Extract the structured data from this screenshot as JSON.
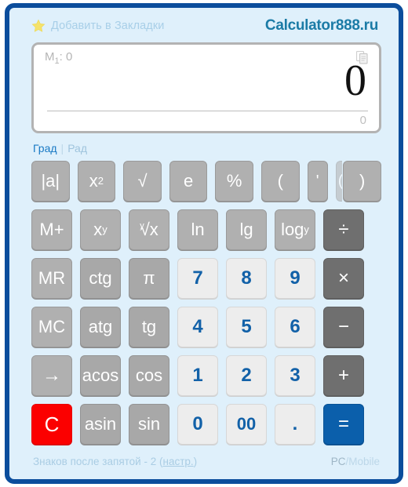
{
  "header": {
    "bookmark_label": "Добавить в Закладки",
    "star_icon": "star-icon",
    "logo": "Calculator888.ru"
  },
  "display": {
    "memory_label_prefix": "M",
    "memory_index": "1",
    "memory_label_suffix": ": 0",
    "copy_icon": "copy-icon",
    "main_value": "0",
    "sub_value": "0"
  },
  "mode": {
    "active_label": "Град",
    "separator": "|",
    "inactive_label": "Рад"
  },
  "keypad": {
    "rows": [
      [
        {
          "label": "|a|",
          "type": "fn",
          "name": "abs-button"
        },
        {
          "label": "x²",
          "type": "fn",
          "name": "square-button"
        },
        {
          "label": "√",
          "type": "fn",
          "name": "sqrt-button"
        },
        {
          "label": "e",
          "type": "fn",
          "name": "e-button"
        },
        {
          "label": "%",
          "type": "fn",
          "name": "percent-button"
        },
        {
          "label": "(",
          "type": "fn",
          "name": "open-paren-button"
        },
        {
          "label": "'",
          "type": "fn-narrow",
          "name": "apostrophe-button"
        },
        {
          "label": "(",
          "type": "fn-sliver",
          "name": "open-paren-partial-button"
        },
        {
          "label": ")",
          "type": "fn",
          "name": "close-paren-button"
        }
      ],
      [
        {
          "label": "M+",
          "type": "fn",
          "name": "memory-add-button"
        },
        {
          "label": "x^y",
          "type": "fn",
          "name": "power-button"
        },
        {
          "label": "y√x",
          "type": "fn",
          "name": "nth-root-button"
        },
        {
          "label": "ln",
          "type": "fn",
          "name": "ln-button"
        },
        {
          "label": "lg",
          "type": "fn",
          "name": "lg-button"
        },
        {
          "label": "log y",
          "type": "fn",
          "name": "log-base-y-button"
        },
        {
          "label": "÷",
          "type": "op",
          "name": "divide-button"
        }
      ],
      [
        {
          "label": "MR",
          "type": "fn",
          "name": "memory-recall-button"
        },
        {
          "label": "ctg",
          "type": "fn-dark",
          "name": "ctg-button"
        },
        {
          "label": "π",
          "type": "fn-dark",
          "name": "pi-button"
        },
        {
          "label": "7",
          "type": "num",
          "name": "digit-7-button"
        },
        {
          "label": "8",
          "type": "num",
          "name": "digit-8-button"
        },
        {
          "label": "9",
          "type": "num",
          "name": "digit-9-button"
        },
        {
          "label": "×",
          "type": "op",
          "name": "multiply-button"
        }
      ],
      [
        {
          "label": "MC",
          "type": "fn",
          "name": "memory-clear-button"
        },
        {
          "label": "atg",
          "type": "fn-dark",
          "name": "atg-button"
        },
        {
          "label": "tg",
          "type": "fn-dark",
          "name": "tg-button"
        },
        {
          "label": "4",
          "type": "num",
          "name": "digit-4-button"
        },
        {
          "label": "5",
          "type": "num",
          "name": "digit-5-button"
        },
        {
          "label": "6",
          "type": "num",
          "name": "digit-6-button"
        },
        {
          "label": "−",
          "type": "op",
          "name": "minus-button"
        }
      ],
      [
        {
          "label": "→",
          "type": "fn",
          "name": "backspace-button"
        },
        {
          "label": "acos",
          "type": "fn-dark",
          "name": "acos-button"
        },
        {
          "label": "cos",
          "type": "fn-dark",
          "name": "cos-button"
        },
        {
          "label": "1",
          "type": "num",
          "name": "digit-1-button"
        },
        {
          "label": "2",
          "type": "num",
          "name": "digit-2-button"
        },
        {
          "label": "3",
          "type": "num",
          "name": "digit-3-button"
        },
        {
          "label": "+",
          "type": "op",
          "name": "plus-button"
        }
      ],
      [
        {
          "label": "C",
          "type": "clear",
          "name": "clear-button"
        },
        {
          "label": "asin",
          "type": "fn-dark",
          "name": "asin-button"
        },
        {
          "label": "sin",
          "type": "fn-dark",
          "name": "sin-button"
        },
        {
          "label": "0",
          "type": "num",
          "name": "digit-0-button"
        },
        {
          "label": "00",
          "type": "num-small",
          "name": "digit-00-button"
        },
        {
          "label": ".",
          "type": "num",
          "name": "decimal-point-button"
        },
        {
          "label": "=",
          "type": "eq",
          "name": "equals-button"
        }
      ]
    ]
  },
  "footer": {
    "decimals_text": "Знаков после запятой - 2",
    "settings_open": "(",
    "settings_link": "настр.",
    "settings_close": ")",
    "pc_label": "PC",
    "mobile_label": "/Mobile"
  },
  "colors": {
    "frame_border": "#0b4d9c",
    "background": "#dff0fb",
    "logo": "#1b7ba6",
    "accent_blue": "#1261a8",
    "equals": "#0b5fab",
    "clear_red": "#fb0000",
    "function_gray": "#b0b0b0",
    "operator_gray": "#6f6f6f"
  }
}
